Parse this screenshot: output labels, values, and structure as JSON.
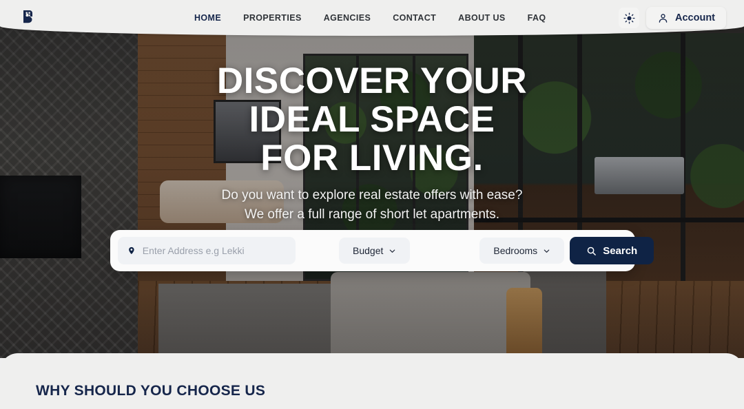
{
  "brand": {
    "logo_icon": "building-house-logo"
  },
  "nav": {
    "items": [
      {
        "label": "HOME",
        "active": true
      },
      {
        "label": "PROPERTIES",
        "active": false
      },
      {
        "label": "AGENCIES",
        "active": false
      },
      {
        "label": "CONTACT",
        "active": false
      },
      {
        "label": "ABOUT US",
        "active": false
      },
      {
        "label": "FAQ",
        "active": false
      }
    ]
  },
  "header_actions": {
    "theme_toggle_icon": "sun-icon",
    "account_label": "Account",
    "account_icon": "user-icon"
  },
  "hero": {
    "title_line1": "DISCOVER YOUR",
    "title_line2": "IDEAL SPACE",
    "title_line3": "FOR LIVING.",
    "subtitle_line1": "Do you want to explore real estate offers with ease?",
    "subtitle_line2": "We offer a full range of short let apartments."
  },
  "search": {
    "address_placeholder": "Enter Address e.g Lekki",
    "address_value": "",
    "location_icon": "map-pin-icon",
    "budget_label": "Budget",
    "bedrooms_label": "Bedrooms",
    "chevron_icon": "chevron-down-icon",
    "search_label": "Search",
    "search_icon": "search-icon"
  },
  "below_section": {
    "heading": "WHY SHOULD YOU CHOOSE US"
  },
  "colors": {
    "navy": "#16264b",
    "button_navy": "#0f2345",
    "header_bg": "#efefee",
    "field_bg": "#f0f2f5"
  }
}
